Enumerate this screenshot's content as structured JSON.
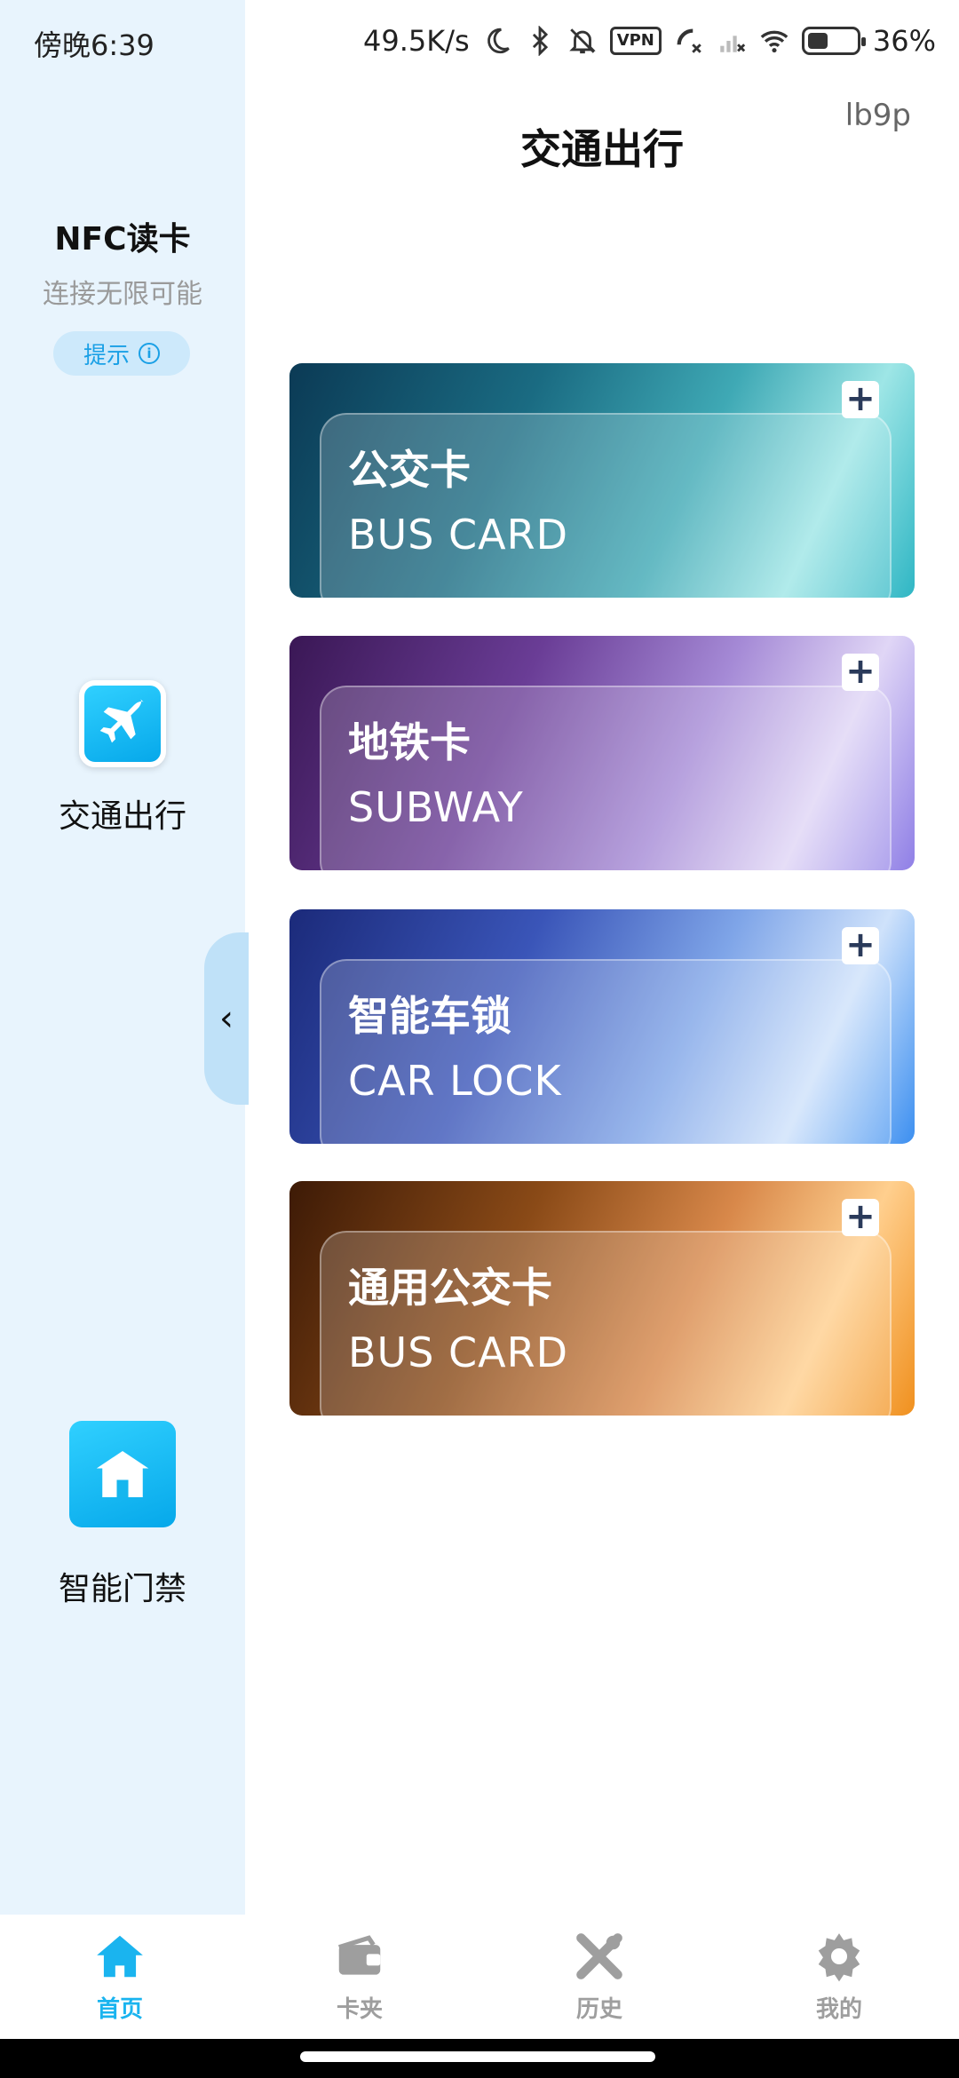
{
  "status_bar": {
    "time": "傍晚6:39",
    "network_speed": "49.5K/s",
    "vpn_label": "VPN",
    "battery_percent": "36%",
    "battery_level": 0.36
  },
  "sidebar": {
    "title": "NFC读卡",
    "subtitle": "连接无限可能",
    "tip_label": "提示",
    "items": [
      {
        "label": "交通出行",
        "icon": "airplane-icon"
      },
      {
        "label": "智能门禁",
        "icon": "house-icon"
      }
    ]
  },
  "main": {
    "title": "交通出行",
    "version_tag": "lb9p"
  },
  "cards": [
    {
      "title_cn": "公交卡",
      "title_en": "BUS CARD",
      "accent": "#1a6b82"
    },
    {
      "title_cn": "地铁卡",
      "title_en": "SUBWAY",
      "accent": "#6a3d96"
    },
    {
      "title_cn": "智能车锁",
      "title_en": "CAR LOCK",
      "accent": "#3a55b8"
    },
    {
      "title_cn": "通用公交卡",
      "title_en": "BUS CARD",
      "accent": "#d8884a"
    }
  ],
  "bottom_nav": {
    "tabs": [
      {
        "label": "首页",
        "icon": "home-icon",
        "active": true
      },
      {
        "label": "卡夹",
        "icon": "wallet-icon",
        "active": false
      },
      {
        "label": "历史",
        "icon": "tools-icon",
        "active": false
      },
      {
        "label": "我的",
        "icon": "gear-icon",
        "active": false
      }
    ]
  },
  "colors": {
    "sidebar_bg": "#e8f4fd",
    "accent": "#1ab4ef",
    "inactive": "#9e9e9e"
  }
}
